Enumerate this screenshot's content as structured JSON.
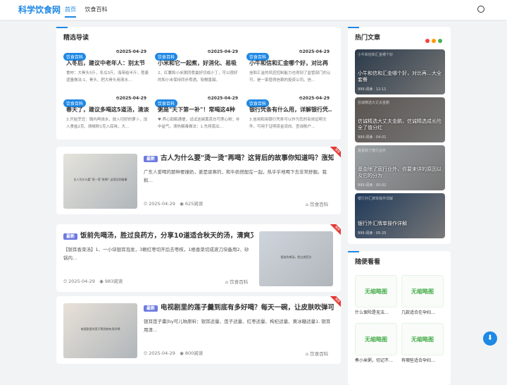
{
  "header": {
    "logo": "科学饮食网",
    "nav": [
      "首页",
      "饮食百科"
    ]
  },
  "featured": {
    "title": "精选导读",
    "items": [
      {
        "badge": "饮食百科",
        "date": "2025-04-29",
        "title": "入冬后，建议中老年人：别太节",
        "desc": "食材：大骨头5斤，冬瓜3斤，海带结半斤，葱姜适量做法:1、骨头、把大骨头用清水…"
      },
      {
        "badge": "饮食百科",
        "date": "2025-04-29",
        "title": "小米和它一起煮，好消化、易吸",
        "desc": "2、红薯和小米粥同煮最好切成小丁，可以很好的和小米保持同步煮透。软糯香甜。"
      },
      {
        "badge": "饮食百科",
        "date": "2025-04-29",
        "title": "小牛和信和汇金哪个好，对比再",
        "desc": "信和汇金的风控控制能力也得到了监管部门的认可，是一家值得信赖的投资公司。信…"
      },
      {
        "badge": "饮食百科",
        "date": "2025-04-29",
        "title": "春天了，建议多喝这5道汤，清淡",
        "desc": "3.开始烹饪：锅内再烧水，放入切好的萝卜，加入食盐2克、胡椒粉1克入底味，大…"
      },
      {
        "badge": "饮食百科",
        "date": "2025-04-29",
        "title": "粥是\"天下第一补\"！常喝这4种",
        "desc": "♥.养心助眠通便，试试这碗黄芪白芍莲心粉；补中益气，清热解毒做法：1.先将南瓜…"
      },
      {
        "badge": "饮食百科",
        "date": "2025-04-29",
        "title": "银行凭条有什么用，详解银行凭…",
        "desc": "3.信用和用银行凭条可以作为您的有效证明文件，可用于证明资金流向、查询账户…"
      }
    ]
  },
  "articles": [
    {
      "tag": "最新",
      "title": "古人为什么要\"烫一烫\"再喝？这背后的故事你知道吗？涨知…",
      "desc": "广东人爱喝的那种要撞奶，姜是驱寒的，和牛奶搭配在一起，热乎乎地喝下去非常舒服。我和…",
      "date": "2025-04-29",
      "views": "625阅读",
      "cat": "饮食百科",
      "ribbon": "推荐",
      "thumb_text": "古人为什么要“烫一烫”再喝？这背后的故事"
    },
    {
      "tag": "最新",
      "title": "饭前先喝汤，胜过良药方，分享10道适合秋天的汤，清爽又…",
      "desc": "【银耳香菜汤】1、一小块银耳泡发，3颗红枣切开后去枣核，1根香菜切成滚刀块备用2、砂锅内…",
      "date": "2025-04-29",
      "views": "983阅读",
      "cat": "饮食百科",
      "ribbon": "推荐",
      "thumb_text": "饭前先喝汤，胜过良药方"
    },
    {
      "tag": "最新",
      "title": "电视剧里的莲子羹到底有多好喝？每天一碗，让皮肤吹弹可破",
      "desc": "银耳莲子羹|by可儿晌原料：银耳适量、莲子适量、红枣适量、枸杞适量、黄冰糖适量1. 银耳用清…",
      "date": "2025-04-29",
      "views": "800阅读",
      "cat": "饮食百科",
      "ribbon": "推荐",
      "thumb_text": "电视剧里的莲子羹到底有多好喝"
    }
  ],
  "hot": {
    "title": "热门文章",
    "dot_colors": [
      "#f44336",
      "#ff9800",
      "#4caf50"
    ],
    "items": [
      {
        "title": "小牛和信和汇金哪个好，对比再…大全套餐",
        "meta": "999 阅读 · 12-11",
        "thumb_text": "小牛和信和汇金哪个好"
      },
      {
        "title": "信诚精选大丈夫金鹏，信诚精选成长险全了值分红",
        "meta": "999 阅读 · 04-01",
        "thumb_text": "信诚精选大丈夫金鹏"
      },
      {
        "title": "基金除了宽行业外，你要来详的原因以及它的分为",
        "meta": "999 阅读 · 05-02",
        "thumb_text": "基金除了宽行业外"
      },
      {
        "title": "银行外汇牌单操作详解",
        "meta": "999 阅读 · 05-25",
        "thumb_text": "银行外汇牌单操作详解"
      }
    ]
  },
  "random": {
    "title": "随便看看",
    "placeholder": "无缩略图",
    "items": [
      "什么保险是无法…",
      "几款适合在孕妇…",
      "煮小米粥，切记不…",
      "有哪些适合孕妇…"
    ]
  },
  "colors": {
    "accent": "#1e88e5",
    "ribbon": "#e53935",
    "tag": "#6c7ae0"
  }
}
